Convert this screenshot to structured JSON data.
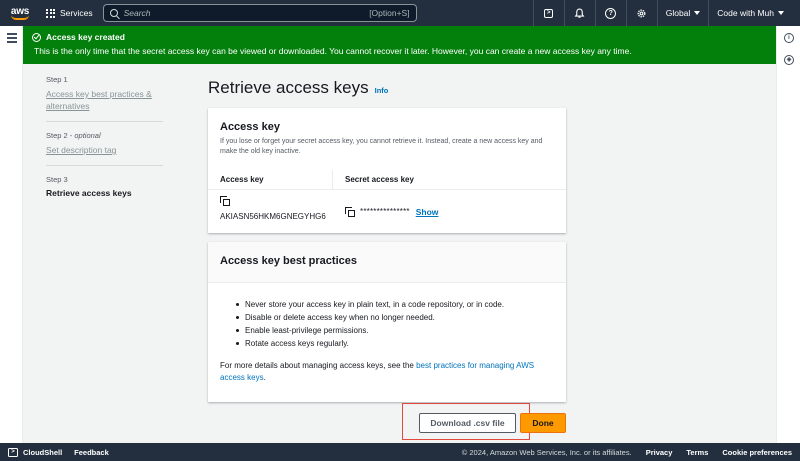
{
  "topnav": {
    "logo_text": "aws",
    "services_label": "Services",
    "search_placeholder": "Search",
    "search_shortcut": "[Option+S]",
    "region_label": "Global",
    "account_label": "Code with Muh",
    "icons": [
      "cloudshell-icon",
      "bell-icon",
      "help-icon",
      "gear-icon"
    ]
  },
  "flash": {
    "title": "Access key created",
    "message": "This is the only time that the secret access key can be viewed or downloaded. You cannot recover it later. However, you can create a new access key any time.",
    "color": "#037f0c"
  },
  "steps": [
    {
      "number": "Step 1",
      "optional": "",
      "label": "Access key best practices & alternatives",
      "current": false
    },
    {
      "number": "Step 2 - ",
      "optional": "optional",
      "label": "Set description tag",
      "current": false
    },
    {
      "number": "Step 3",
      "optional": "",
      "label": "Retrieve access keys",
      "current": true
    }
  ],
  "page": {
    "title": "Retrieve access keys",
    "info_label": "Info"
  },
  "access_key_card": {
    "title": "Access key",
    "description": "If you lose or forget your secret access key, you cannot retrieve it. Instead, create a new access key and make the old key inactive.",
    "col_access_key": "Access key",
    "col_secret_key": "Secret access key",
    "access_key_id": "AKIASN56HKM6GNEGYHG6",
    "secret_masked": "***************",
    "show_label": "Show"
  },
  "best_practices_card": {
    "title": "Access key best practices",
    "items": [
      "Never store your access key in plain text, in a code repository, or in code.",
      "Disable or delete access key when no longer needed.",
      "Enable least-privilege permissions.",
      "Rotate access keys regularly."
    ],
    "more_prefix": "For more details about managing access keys, see the ",
    "more_link": "best practices for managing AWS access keys",
    "more_suffix": "."
  },
  "actions": {
    "download_label": "Download .csv file",
    "done_label": "Done",
    "done_color": "#ff9900",
    "highlight_color": "#e3493d"
  },
  "footer": {
    "cloudshell_label": "CloudShell",
    "feedback_label": "Feedback",
    "copyright": "© 2024, Amazon Web Services, Inc. or its affiliates.",
    "privacy_label": "Privacy",
    "terms_label": "Terms",
    "cookie_label": "Cookie preferences"
  }
}
